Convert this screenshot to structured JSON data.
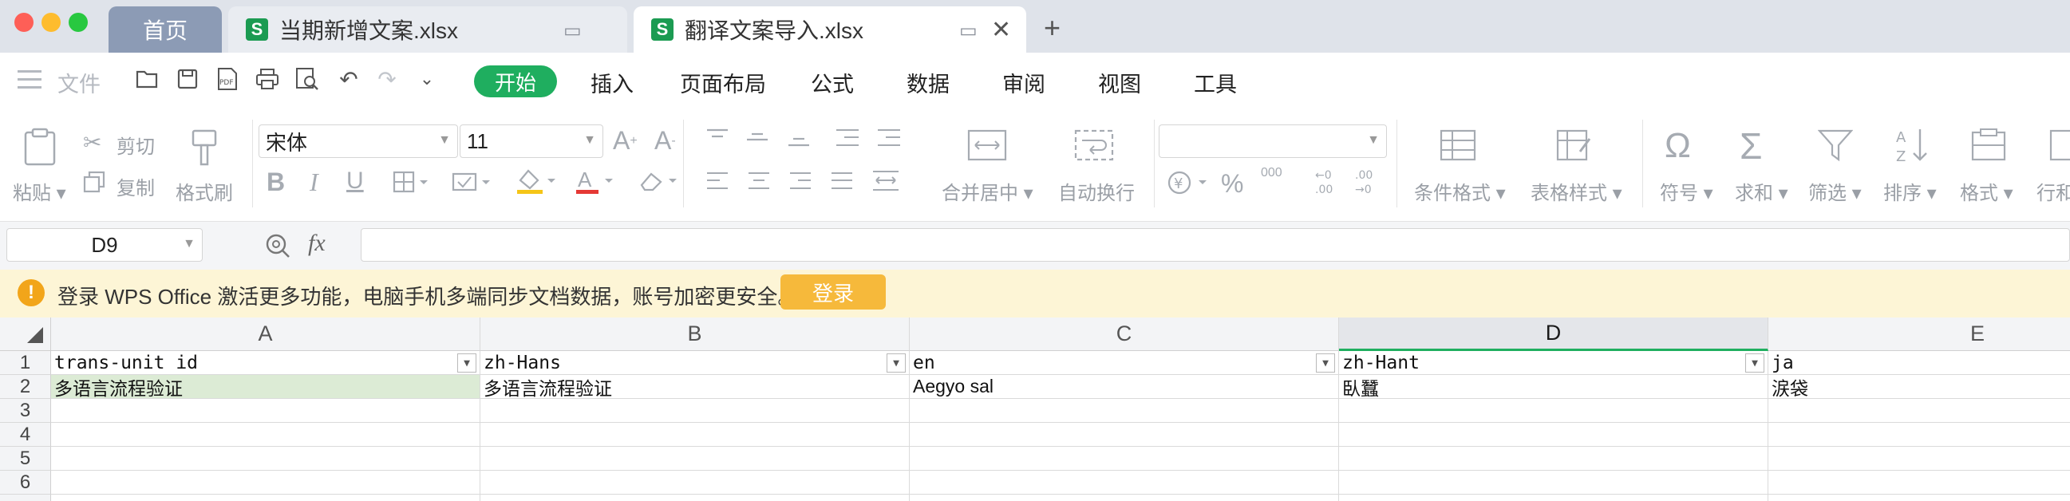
{
  "tabs": {
    "home": "首页",
    "doc1": "当期新增文案.xlsx",
    "doc2": "翻译文案导入.xlsx",
    "new_tab": "+",
    "doc_icon": "S"
  },
  "menu": {
    "file": "文件",
    "start": "开始",
    "insert": "插入",
    "layout": "页面布局",
    "formula": "公式",
    "data": "数据",
    "review": "审阅",
    "view": "视图",
    "tools": "工具"
  },
  "ribbon": {
    "paste": "粘贴",
    "cut": "剪切",
    "copy": "复制",
    "format_painter": "格式刷",
    "font_name": "宋体",
    "font_size": "11",
    "merge_center": "合并居中",
    "wrap_text": "自动换行",
    "number_format": "",
    "percent": "%",
    "thousands": "000",
    "cond_format": "条件格式",
    "table_style": "表格样式",
    "symbol": "符号",
    "sum": "求和",
    "filter": "筛选",
    "sort": "排序",
    "format": "格式",
    "row_col": "行和"
  },
  "formula_bar": {
    "cell_ref": "D9",
    "fx": "fx",
    "content": ""
  },
  "notice": {
    "icon": "!",
    "text": "登录 WPS Office 激活更多功能，电脑手机多端同步文档数据，账号加密更安全。",
    "login": "登录"
  },
  "sheet": {
    "columns": [
      "A",
      "B",
      "C",
      "D",
      "E"
    ],
    "selected_column": "D",
    "rows": [
      "1",
      "2",
      "3",
      "4",
      "5",
      "6"
    ],
    "row1": [
      "trans-unit id",
      "zh-Hans",
      "en",
      "zh-Hant",
      "ja"
    ],
    "row2": [
      "多语言流程验证",
      "多语言流程验证",
      "Aegyo sal",
      "臥蠶",
      "涙袋"
    ],
    "colors": {
      "accent": "#1fae5f",
      "highlight_cell": "#dcebd5",
      "notice_bg": "#fdf5d6",
      "login_button": "#f6b93b"
    }
  }
}
